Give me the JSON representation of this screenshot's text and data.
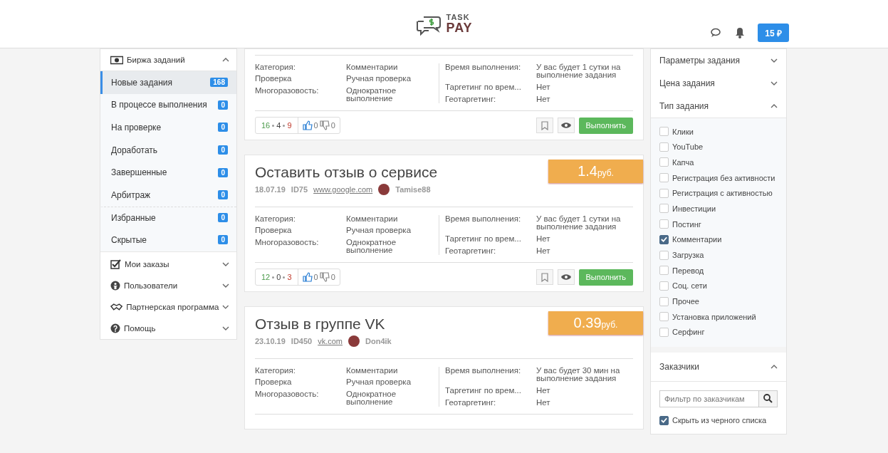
{
  "header": {
    "logo_top": "TASK",
    "logo_bottom": "PAY",
    "balance": "15 ₽"
  },
  "sidebar": {
    "groups": [
      {
        "label": "Биржа заданий",
        "expanded": true,
        "items": [
          {
            "label": "Новые задания",
            "count": "168",
            "selected": true,
            "divider_before": false
          },
          {
            "label": "В процессе выполнения",
            "count": "0",
            "selected": false,
            "divider_before": false
          },
          {
            "label": "На проверке",
            "count": "0",
            "selected": false,
            "divider_before": false
          },
          {
            "label": "Доработать",
            "count": "0",
            "selected": false,
            "divider_before": false
          },
          {
            "label": "Завершенные",
            "count": "0",
            "selected": false,
            "divider_before": false
          },
          {
            "label": "Арбитраж",
            "count": "0",
            "selected": false,
            "divider_before": false
          },
          {
            "label": "Избранные",
            "count": "0",
            "selected": false,
            "divider_before": true
          },
          {
            "label": "Скрытые",
            "count": "0",
            "selected": false,
            "divider_before": false
          }
        ]
      },
      {
        "label": "Мои заказы",
        "expanded": false
      },
      {
        "label": "Пользователи",
        "expanded": false
      },
      {
        "label": "Партнерская программа",
        "expanded": false
      },
      {
        "label": "Помощь",
        "expanded": false
      }
    ]
  },
  "tasks": [
    {
      "details_left": [
        [
          "Категория:",
          "Комментарии"
        ],
        [
          "Проверка",
          "Ручная проверка"
        ],
        [
          "Многоразовость:",
          "Однократное выполнение"
        ]
      ],
      "details_right": [
        [
          "Время выполнения:",
          "У вас будет 1 сутки на выполнение задания"
        ],
        [
          "Таргетинг по врем...",
          "Нет"
        ],
        [
          "Геотаргетинг:",
          "Нет"
        ]
      ],
      "stats": [
        "16",
        "4",
        "9"
      ],
      "likes": "0",
      "dislikes": "0",
      "action": "Выполнить"
    },
    {
      "title": "Оставить отзыв о сервисе",
      "price": "1.4",
      "currency": "руб.",
      "date": "18.07.19",
      "id": "ID75",
      "site": "www.google.com",
      "author": "Tamise88",
      "details_left": [
        [
          "Категория:",
          "Комментарии"
        ],
        [
          "Проверка",
          "Ручная проверка"
        ],
        [
          "Многоразовость:",
          "Однократное выполнение"
        ]
      ],
      "details_right": [
        [
          "Время выполнения:",
          "У вас будет 1 сутки на выполнение задания"
        ],
        [
          "Таргетинг по врем...",
          "Нет"
        ],
        [
          "Геотаргетинг:",
          "Нет"
        ]
      ],
      "stats": [
        "12",
        "0",
        "3"
      ],
      "likes": "0",
      "dislikes": "0",
      "action": "Выполнить"
    },
    {
      "title": "Отзыв в группе VK",
      "price": "0.39",
      "currency": "руб.",
      "date": "23.10.19",
      "id": "ID450",
      "site": "vk.com",
      "author": "Don4ik",
      "details_left": [
        [
          "Категория:",
          "Комментарии"
        ],
        [
          "Проверка",
          "Ручная проверка"
        ],
        [
          "Многоразовость:",
          "Однократное выполнение"
        ]
      ],
      "details_right": [
        [
          "Время выполнения:",
          "У вас будет 30 мин на выполнение задания"
        ],
        [
          "Таргетинг по врем...",
          "Нет"
        ],
        [
          "Геотаргетинг:",
          "Нет"
        ]
      ]
    }
  ],
  "filters": {
    "sections": [
      {
        "label": "Параметры задания",
        "expanded": false
      },
      {
        "label": "Цена задания",
        "expanded": false
      },
      {
        "label": "Тип задания",
        "expanded": true
      }
    ],
    "types": [
      {
        "label": "Клики",
        "checked": false
      },
      {
        "label": "YouTube",
        "checked": false
      },
      {
        "label": "Капча",
        "checked": false
      },
      {
        "label": "Регистрация без активности",
        "checked": false
      },
      {
        "label": "Регистрация с активностью",
        "checked": false
      },
      {
        "label": "Инвестиции",
        "checked": false
      },
      {
        "label": "Постинг",
        "checked": false
      },
      {
        "label": "Комментарии",
        "checked": true
      },
      {
        "label": "Загрузка",
        "checked": false
      },
      {
        "label": "Перевод",
        "checked": false
      },
      {
        "label": "Соц. сети",
        "checked": false
      },
      {
        "label": "Прочее",
        "checked": false
      },
      {
        "label": "Установка приложений",
        "checked": false
      },
      {
        "label": "Серфинг",
        "checked": false
      }
    ],
    "customers": {
      "label": "Заказчики",
      "expanded": true,
      "placeholder": "Фильтр по заказчикам",
      "hide_blacklist": {
        "label": "Скрыть из черного списка",
        "checked": true
      }
    }
  }
}
